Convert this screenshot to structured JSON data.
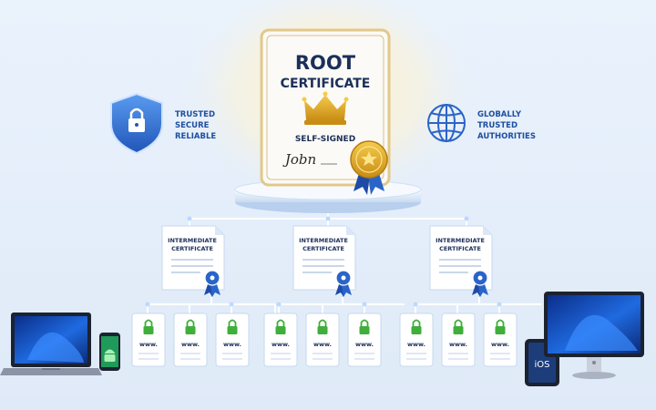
{
  "root_certificate": {
    "title_line1": "ROOT",
    "title_line2": "CERTIFICATE",
    "subtitle": "SELF-SIGNED",
    "signature": "Jobn"
  },
  "left_badge": {
    "icon": "shield-lock-icon",
    "lines": [
      "TRUSTED",
      "SECURE",
      "RELIABLE"
    ]
  },
  "right_badge": {
    "icon": "globe-icon",
    "lines": [
      "GLOBALLY",
      "TRUSTED",
      "AUTHORITIES"
    ]
  },
  "intermediates": [
    {
      "line1": "INTERMEDIATE",
      "line2": "CERTIFICATE"
    },
    {
      "line1": "INTERMEDIATE",
      "line2": "CERTIFICATE"
    },
    {
      "line1": "INTERMEDIATE",
      "line2": "CERTIFICATE"
    }
  ],
  "leaf_label": "www.",
  "devices": {
    "tablet_label": "iOS"
  },
  "colors": {
    "accent_blue": "#2a64c8",
    "gold": "#d9a21f",
    "lock_green": "#3fae3a",
    "background": "#e6f0fb"
  }
}
